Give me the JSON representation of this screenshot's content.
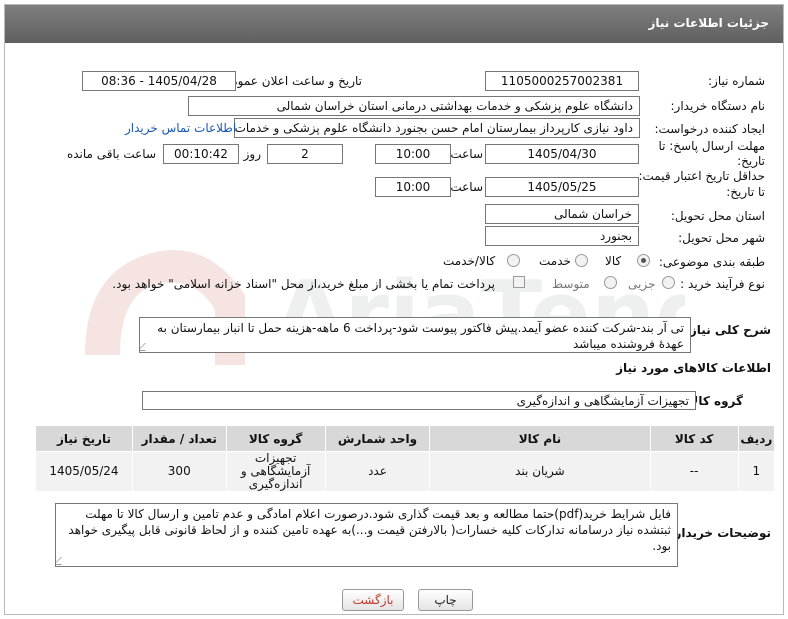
{
  "header": {
    "title": "جزئیات اطلاعات نیاز"
  },
  "form": {
    "need_number": {
      "label": "شماره نیاز:",
      "value": "1105000257002381"
    },
    "announce_datetime": {
      "label": "تاریخ و ساعت اعلان عمومی:",
      "value": "1405/04/28 - 08:36"
    },
    "buyer_org": {
      "label": "نام دستگاه خریدار:",
      "value": "دانشگاه علوم پزشکی و خدمات بهداشتی درمانی استان خراسان شمالی"
    },
    "requester": {
      "label": "ایجاد کننده درخواست:",
      "value": "داود نیازی کارپرداز بیمارستان امام حسن بجنورد دانشگاه علوم پزشکی و خدمات",
      "contact_link": "اطلاعات تماس خریدار"
    },
    "deadline": {
      "label_line1": "مهلت ارسال پاسخ: تا",
      "label_line2": "تاریخ:",
      "date": "1405/04/30",
      "time_label": "ساعت",
      "time": "10:00",
      "days": "2",
      "days_label": "روز و",
      "remaining": "00:10:42",
      "remaining_label": "ساعت باقی مانده"
    },
    "validity": {
      "label_line1": "حداقل تاریخ اعتبار قیمت:",
      "label_line2": "تا تاریخ:",
      "date": "1405/05/25",
      "time_label": "ساعت",
      "time": "10:00"
    },
    "province": {
      "label": "استان محل تحویل:",
      "value": "خراسان شمالی"
    },
    "city": {
      "label": "شهر محل تحویل:",
      "value": "بجنورد"
    },
    "category": {
      "label": "طبقه بندی موضوعی:",
      "options": [
        "کالا",
        "خدمت",
        "کالا/خدمت"
      ],
      "selected": "کالا"
    },
    "purchase_type": {
      "label": "نوع فرآیند خرید :",
      "options": [
        "جزیی",
        "متوسط"
      ],
      "payment_note": "پرداخت تمام یا بخشی از مبلغ خرید،از محل \"اسناد خزانه اسلامی\" خواهد بود."
    }
  },
  "description": {
    "label": "شرح کلی نیاز:",
    "text": "تی آر بند-شرکت کننده عضو آیمد.پیش فاکتور پیوست  شود-پرداخت 6 ماهه-هزینه حمل تا انبار بیمارستان به عهدۀ فروشنده میباشد"
  },
  "goods_section": {
    "title": "اطلاعات کالاهای مورد نیاز"
  },
  "goods_group": {
    "label": "گروه کالا:",
    "value": "تجهیزات آزمایشگاهی و اندازه‌گیری"
  },
  "table": {
    "headers": [
      "ردیف",
      "کد کالا",
      "نام کالا",
      "واحد شمارش",
      "گروه کالا",
      "تعداد / مقدار",
      "تاریخ نیاز"
    ],
    "rows": [
      [
        "1",
        "--",
        "شریان بند",
        "عدد",
        "تجهیزات آزمایشگاهی و اندازه‌گیری",
        "300",
        "1405/05/24"
      ]
    ]
  },
  "buyer_notes": {
    "label": "توضیحات خریدار:",
    "text": "فایل شرایط خرید(pdf)حتما مطالعه و بعد قیمت گذاری شود.درصورت اعلام امادگی و عدم تامین و ارسال کالا تا مهلت ثبتشده نیاز درسامانه تدارکات کلیه خسارات( بالارفتن قیمت و...)به عهده تامین کننده و از لحاظ قانونی قابل پیگیری خواهد بود."
  },
  "buttons": {
    "print": "چاپ",
    "back": "بازگشت"
  },
  "colors": {
    "header": "#6f6f6f",
    "link": "#1a56b7",
    "back_text": "#c0392b"
  }
}
